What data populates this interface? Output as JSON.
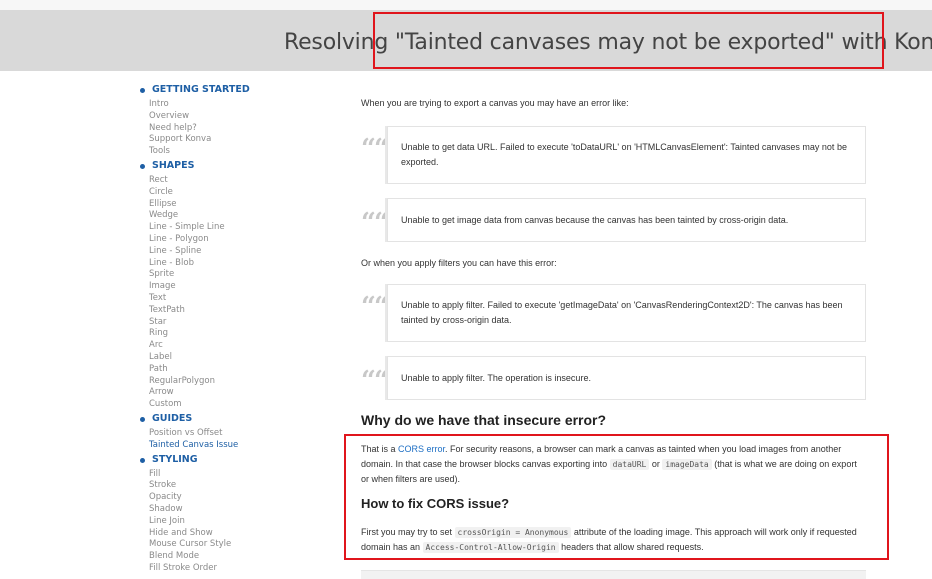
{
  "header": {
    "title": "Resolving \"Tainted canvases may not be exported\" with Konva"
  },
  "sidebar": {
    "sections": [
      {
        "label": "GETTING STARTED",
        "items": [
          "Intro",
          "Overview",
          "Need help?",
          "Support Konva",
          "Tools"
        ]
      },
      {
        "label": "SHAPES",
        "items": [
          "Rect",
          "Circle",
          "Ellipse",
          "Wedge",
          "Line - Simple Line",
          "Line - Polygon",
          "Line - Spline",
          "Line - Blob",
          "Sprite",
          "Image",
          "Text",
          "TextPath",
          "Star",
          "Ring",
          "Arc",
          "Label",
          "Path",
          "RegularPolygon",
          "Arrow",
          "Custom"
        ]
      },
      {
        "label": "GUIDES",
        "items": [
          "Position vs Offset",
          "Tainted Canvas Issue"
        ]
      },
      {
        "label": "STYLING",
        "items": [
          "Fill",
          "Stroke",
          "Opacity",
          "Shadow",
          "Line Join",
          "Hide and Show",
          "Mouse Cursor Style",
          "Blend Mode",
          "Fill Stroke Order"
        ]
      }
    ],
    "active_item": "Tainted Canvas Issue"
  },
  "content": {
    "intro": "When you are trying to export a canvas you may have an error like:",
    "quote1": "Unable to get data URL. Failed to execute 'toDataURL' on 'HTMLCanvasElement': Tainted canvases may not be exported.",
    "quote2": "Unable to get image data from canvas because the canvas has been tainted by cross-origin data.",
    "filters_intro": "Or when you apply filters you can have this error:",
    "quote3": "Unable to apply filter. Failed to execute 'getImageData' on 'CanvasRenderingContext2D': The canvas has been tainted by cross-origin data.",
    "quote4": "Unable to apply filter. The operation is insecure.",
    "h2_why": "Why do we have that insecure error?",
    "why_p1": "That is a ",
    "why_link": "CORS error",
    "why_p2": ". For security reasons, a browser can mark a canvas as tainted when you load images from another domain. In that case the browser blocks canvas exporting into ",
    "why_code1": "dataURL",
    "why_or": " or ",
    "why_code2": "imageData",
    "why_p3": " (that is what we are doing on export or when filters are used).",
    "h2_fix": "How to fix CORS issue?",
    "fix_p1": "First you may try to set ",
    "fix_code1": "crossOrigin = Anonymous",
    "fix_p2": " attribute of the loading image. This approach will work only if requested domain has an ",
    "fix_code2": "Access-Control-Allow-Origin",
    "fix_p3": " headers that allow shared requests."
  },
  "colors": {
    "accent": "#1e5fa5",
    "link": "#1e6fc4",
    "annotation_red": "#e0151c",
    "header_bg": "#d9d9d9"
  }
}
